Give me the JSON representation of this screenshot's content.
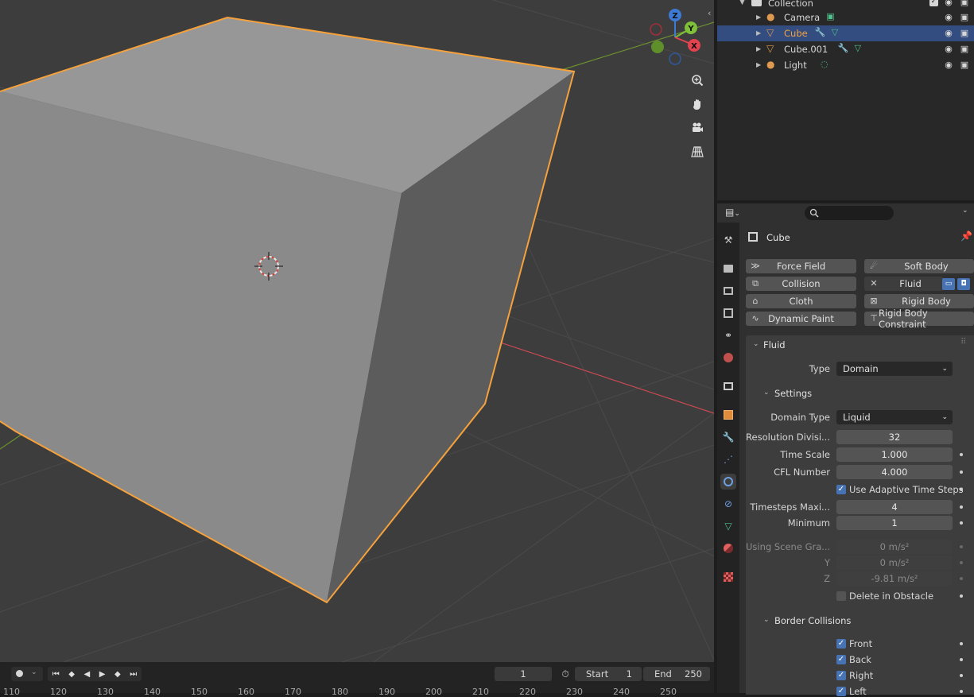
{
  "outliner": {
    "collection_label": "Collection",
    "items": [
      {
        "name": "Camera",
        "icon": "camera-object-icon",
        "extra_icons": [
          "camera-data-icon"
        ],
        "selected": false
      },
      {
        "name": "Cube",
        "icon": "mesh-object-icon",
        "extra_icons": [
          "wrench-modifier-icon",
          "mesh-data-icon"
        ],
        "selected": true
      },
      {
        "name": "Cube.001",
        "icon": "mesh-object-icon",
        "extra_icons": [
          "wrench-modifier-icon",
          "mesh-data-icon"
        ],
        "selected": false
      },
      {
        "name": "Light",
        "icon": "light-object-icon",
        "extra_icons": [
          "light-data-icon"
        ],
        "selected": false
      }
    ]
  },
  "properties": {
    "object_name": "Cube",
    "physics_buttons": [
      {
        "label": "Force Field",
        "icon": "force-field-icon"
      },
      {
        "label": "Soft Body",
        "icon": "soft-body-icon"
      },
      {
        "label": "Collision",
        "icon": "collision-icon"
      },
      {
        "label": "Fluid",
        "icon": "close-icon"
      },
      {
        "label": "Cloth",
        "icon": "cloth-icon"
      },
      {
        "label": "Rigid Body",
        "icon": "rigid-body-icon"
      },
      {
        "label": "Dynamic Paint",
        "icon": "dynamic-paint-icon"
      },
      {
        "label": "Rigid Body Constraint",
        "icon": "rigid-body-constraint-icon"
      }
    ],
    "fluid": {
      "section_title": "Fluid",
      "type_label": "Type",
      "type_value": "Domain",
      "settings_title": "Settings",
      "domain_type_label": "Domain Type",
      "domain_type_value": "Liquid",
      "resolution_label": "Resolution Divisi...",
      "resolution_value": "32",
      "time_scale_label": "Time Scale",
      "time_scale_value": "1.000",
      "cfl_label": "CFL Number",
      "cfl_value": "4.000",
      "adaptive_label": "Use Adaptive Time Steps",
      "adaptive_checked": true,
      "timesteps_max_label": "Timesteps Maxi...",
      "timesteps_max_value": "4",
      "minimum_label": "Minimum",
      "minimum_value": "1",
      "gravity_label": "Using Scene Gra...",
      "gravity_x": "0 m/s²",
      "gravity_y_label": "Y",
      "gravity_y": "0 m/s²",
      "gravity_z_label": "Z",
      "gravity_z": "-9.81 m/s²",
      "delete_obstacle_label": "Delete in Obstacle",
      "delete_obstacle_checked": false,
      "border_title": "Border Collisions",
      "borders": [
        {
          "label": "Front",
          "checked": true
        },
        {
          "label": "Back",
          "checked": true
        },
        {
          "label": "Right",
          "checked": true
        },
        {
          "label": "Left",
          "checked": true
        }
      ]
    }
  },
  "timeline": {
    "current_frame": "1",
    "start_label": "Start",
    "start_value": "1",
    "end_label": "End",
    "end_value": "250",
    "ruler": [
      "110",
      "120",
      "130",
      "140",
      "150",
      "160",
      "170",
      "180",
      "190",
      "200",
      "210",
      "220",
      "230",
      "240",
      "250"
    ]
  },
  "gizmo": {
    "z": "Z",
    "y": "Y",
    "x": "X"
  },
  "colors": {
    "selection_outline": "#f5a13c",
    "x_axis": "#c94a52",
    "y_axis": "#6b8f2e",
    "active_blue": "#4772b3"
  }
}
